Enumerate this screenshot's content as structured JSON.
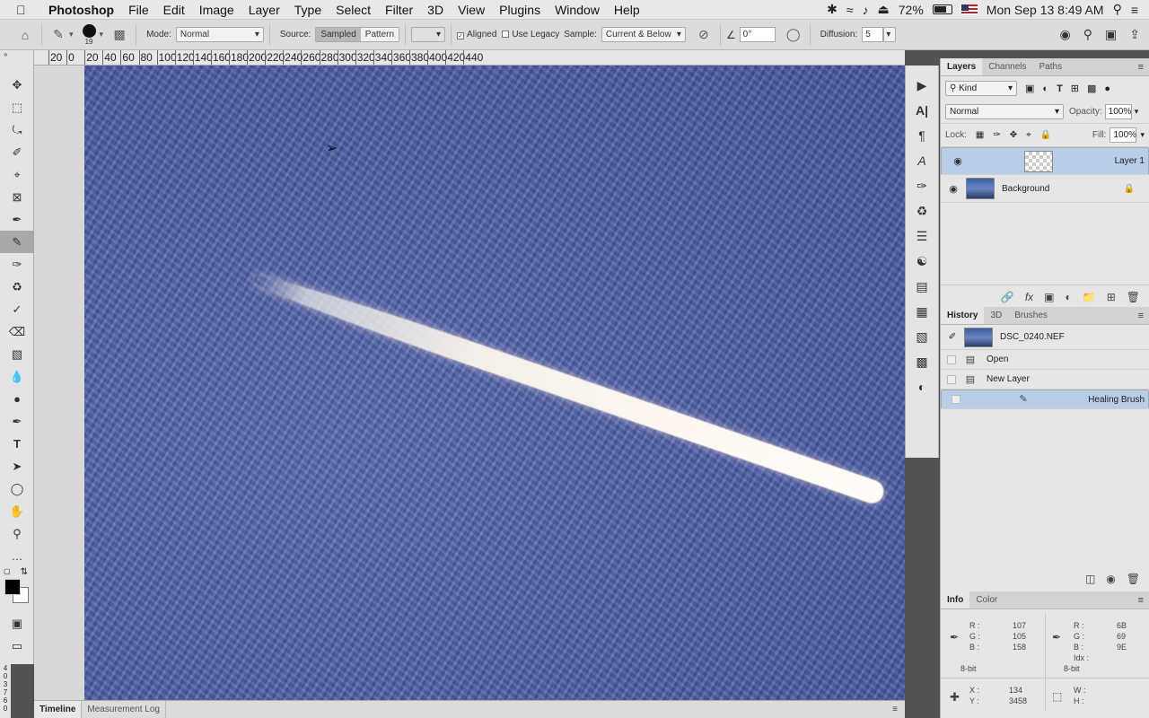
{
  "menubar": {
    "app_name": "Photoshop",
    "items": [
      "File",
      "Edit",
      "Image",
      "Layer",
      "Type",
      "Select",
      "Filter",
      "3D",
      "View",
      "Plugins",
      "Window",
      "Help"
    ],
    "battery": "72%",
    "battery_level": 0.72,
    "clock": "Mon Sep 13  8:49 AM"
  },
  "options": {
    "brush_size": "19",
    "mode_label": "Mode:",
    "mode_value": "Normal",
    "source_label": "Source:",
    "source_sampled": "Sampled",
    "source_pattern": "Pattern",
    "aligned_label": "Aligned",
    "legacy_label": "Use Legacy",
    "sample_label": "Sample:",
    "sample_value": "Current & Below",
    "angle_value": "0°",
    "diffusion_label": "Diffusion:",
    "diffusion_value": "5"
  },
  "ruler": {
    "labels": [
      "20",
      "0",
      "20",
      "40",
      "60",
      "80",
      "100",
      "120",
      "140",
      "160",
      "180",
      "200",
      "220",
      "240",
      "260",
      "280",
      "300",
      "320",
      "340",
      "360",
      "380",
      "400",
      "420",
      "440"
    ],
    "vertical_digits": [
      "4",
      "0",
      "3",
      "7",
      "6",
      "0"
    ]
  },
  "statusbar": {
    "timeline": "Timeline",
    "measurement": "Measurement Log"
  },
  "layers_panel": {
    "tabs": [
      "Layers",
      "Channels",
      "Paths"
    ],
    "kind_label": "Kind",
    "blend_mode": "Normal",
    "opacity_label": "Opacity:",
    "opacity_value": "100%",
    "lock_label": "Lock:",
    "fill_label": "Fill:",
    "fill_value": "100%",
    "layers": [
      {
        "name": "Layer 1",
        "selected": true
      },
      {
        "name": "Background",
        "selected": false
      }
    ]
  },
  "history_panel": {
    "tabs": [
      "History",
      "3D",
      "Brushes"
    ],
    "snapshot": "DSC_0240.NEF",
    "states": [
      "Open",
      "New Layer",
      "Healing Brush"
    ]
  },
  "info_panel": {
    "tabs": [
      "Info",
      "Color"
    ],
    "left": {
      "r_label": "R :",
      "r": "107",
      "g_label": "G :",
      "g": "105",
      "b_label": "B :",
      "b": "158",
      "bits": "8-bit"
    },
    "right": {
      "r_label": "R :",
      "r": "6B",
      "g_label": "G :",
      "g": "69",
      "b_label": "B :",
      "b": "9E",
      "idx_label": "Idx :",
      "bits": "8-bit"
    },
    "x_label": "X :",
    "x": "134",
    "y_label": "Y :",
    "y": "3458",
    "w_label": "W :",
    "h_label": "H :"
  },
  "colors": {
    "selection": "#b8cde8",
    "canvas_blue": "#4c5ea8",
    "chrome": "#e4e4e4"
  }
}
